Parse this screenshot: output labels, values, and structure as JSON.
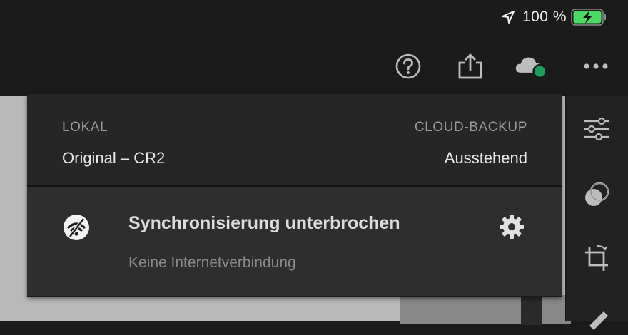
{
  "status_bar": {
    "location_icon": "location-arrow-icon",
    "battery_percent": "100 %",
    "battery_icon": "battery-charging-icon",
    "battery_color": "#4cd964"
  },
  "toolbar": {
    "icons": [
      "help-icon",
      "share-icon",
      "cloud-status-icon",
      "more-icon"
    ],
    "cloud_status_color": "#1a9e5b"
  },
  "info_popover": {
    "local_label": "LOKAL",
    "local_value": "Original – CR2",
    "cloud_label": "CLOUD-BACKUP",
    "cloud_value": "Ausstehend"
  },
  "sync_status": {
    "icon": "sync-paused-icon",
    "title": "Synchronisierung unterbrochen",
    "subtitle": "Keine Internetverbindung",
    "settings_icon": "gear-icon"
  },
  "right_panel": {
    "icons": [
      "adjust-sliders-icon",
      "presets-icon",
      "crop-icon",
      "brush-icon"
    ]
  }
}
